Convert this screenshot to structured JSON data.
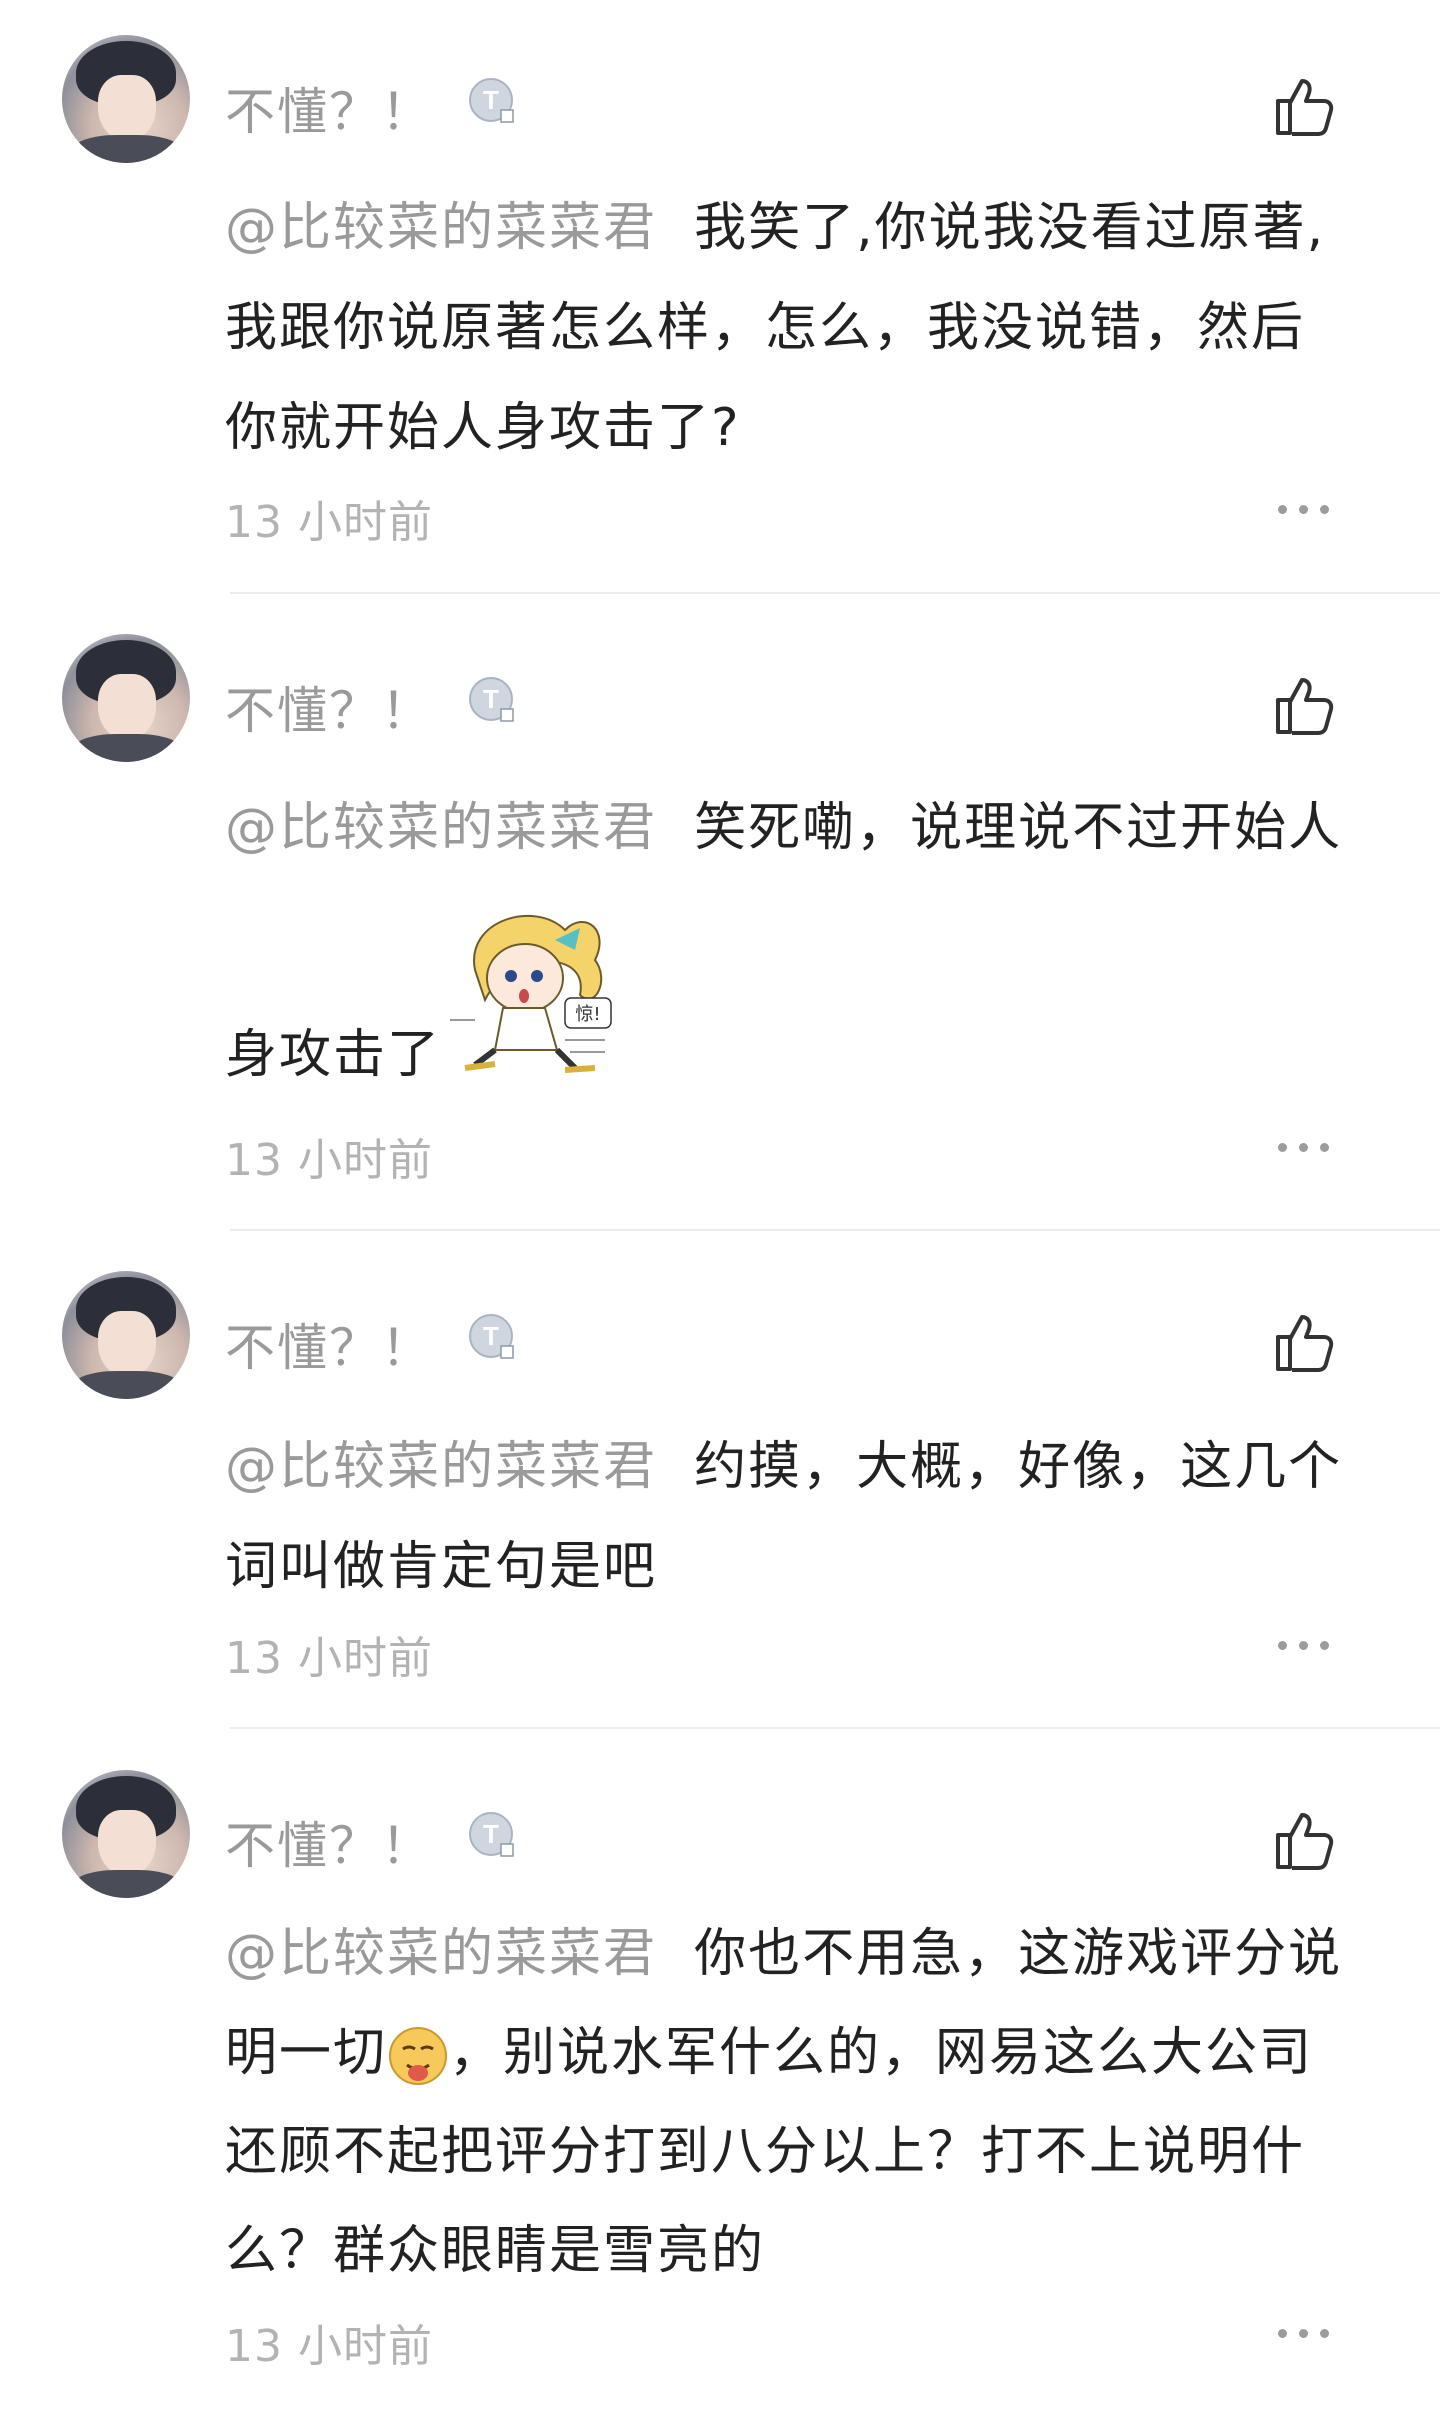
{
  "comments": [
    {
      "username": "不懂？！",
      "mention": "@比较菜的菜菜君",
      "lines": [
        "我笑了,你说我没看过原著,",
        "我跟你说原著怎么样，怎么，我没说错，然后",
        "你就开始人身攻击了?"
      ],
      "time": "13 小时前"
    },
    {
      "username": "不懂？！",
      "mention": "@比较菜的菜菜君",
      "lines": [
        "笑死嘞，说理说不过开始人",
        "身攻击了"
      ],
      "sticker_icon": "surprised-anime-girl-sticker",
      "sticker_text": "惊!",
      "time": "13 小时前"
    },
    {
      "username": "不懂？！",
      "mention": "@比较菜的菜菜君",
      "lines": [
        "约摸，大概，好像，这几个",
        "词叫做肯定句是吧"
      ],
      "time": "13 小时前"
    },
    {
      "username": "不懂？！",
      "mention": "@比较菜的菜菜君",
      "lines": [
        "你也不用急，这游戏评分说",
        "明一切",
        "，别说水军什么的，网易这么大公司",
        "还顾不起把评分打到八分以上？打不上说明什",
        "么？群众眼睛是雪亮的"
      ],
      "emoji_icon": "smirk-emoji",
      "time": "13 小时前"
    }
  ],
  "icons": {
    "badge": "t-level-badge-icon",
    "like": "thumbs-up-icon",
    "more": "more-options-icon"
  },
  "colors": {
    "username": "#9a9a9a",
    "text": "#222222",
    "time": "#b3b3b3"
  }
}
